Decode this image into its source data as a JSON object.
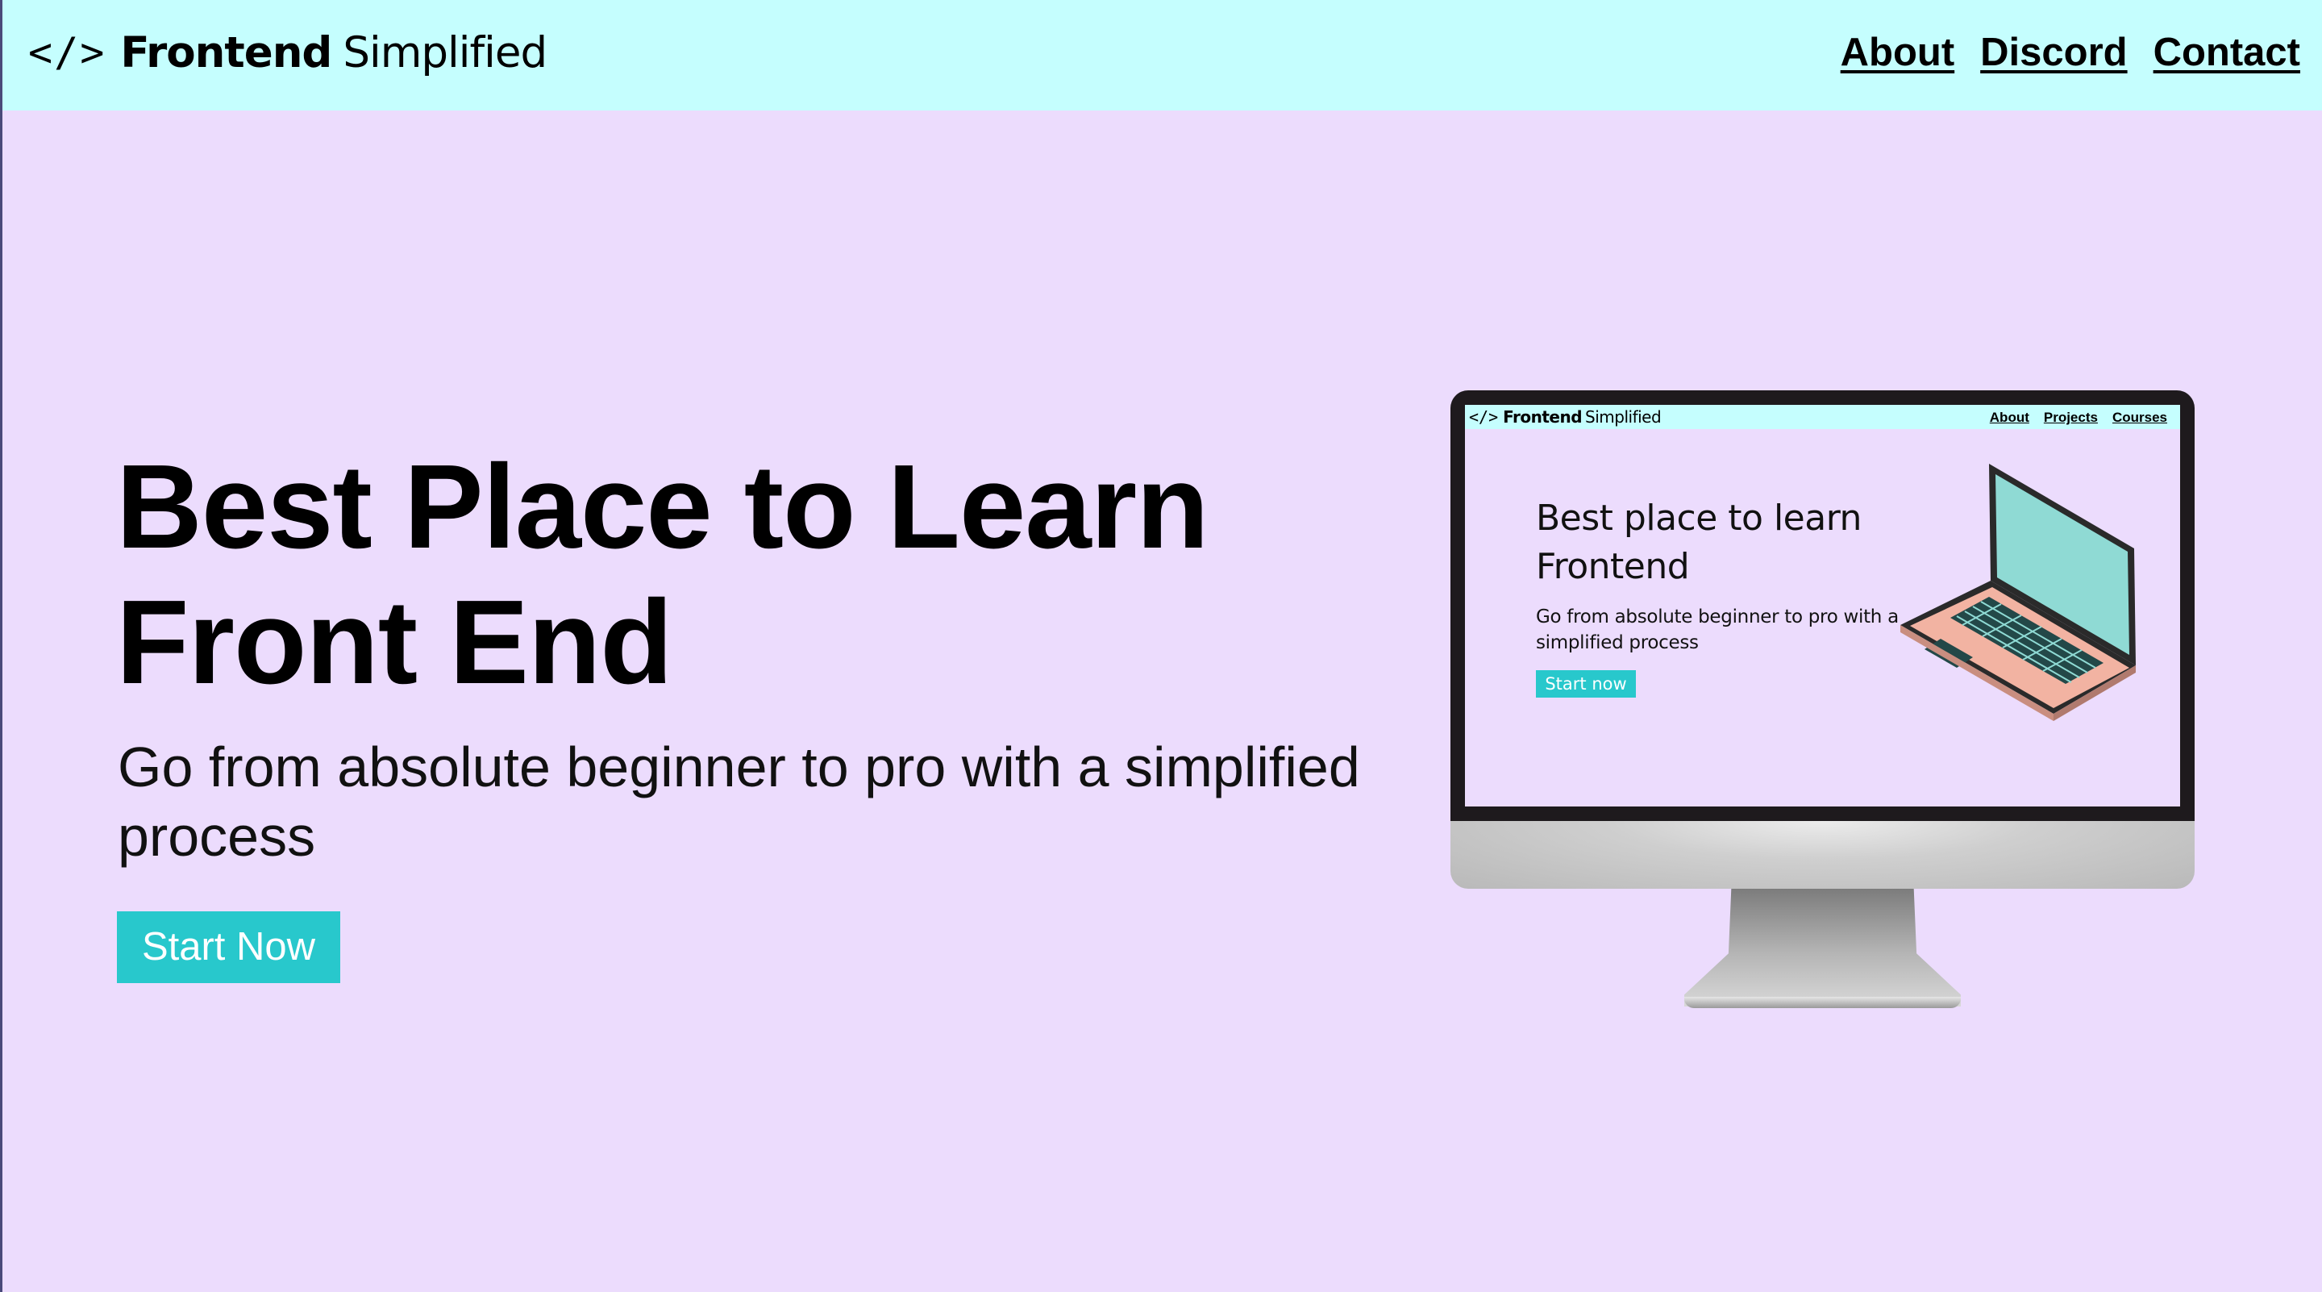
{
  "nav": {
    "logo": {
      "glyph": "</>",
      "bold": "Frontend",
      "light": "Simplified"
    },
    "links": [
      "About",
      "Discord",
      "Contact"
    ]
  },
  "hero": {
    "title_line1": "Best Place to Learn",
    "title_line2": "Front End",
    "subtitle": "Go from absolute beginner to pro with a simplified process",
    "cta": "Start Now"
  },
  "illustration": {
    "nav": {
      "logo_glyph": "</>",
      "logo_bold": "Frontend",
      "logo_light": "Simplified",
      "links": [
        "About",
        "Projects",
        "Courses"
      ]
    },
    "title_line1": "Best place to learn",
    "title_line2": "Frontend",
    "subtitle": "Go from absolute beginner to pro with a simplified process",
    "cta": "Start now"
  },
  "colors": {
    "page_background": "#ecdcfd",
    "navbar_background": "#c5fefe",
    "accent": "#28c8cc",
    "text": "#000000"
  }
}
